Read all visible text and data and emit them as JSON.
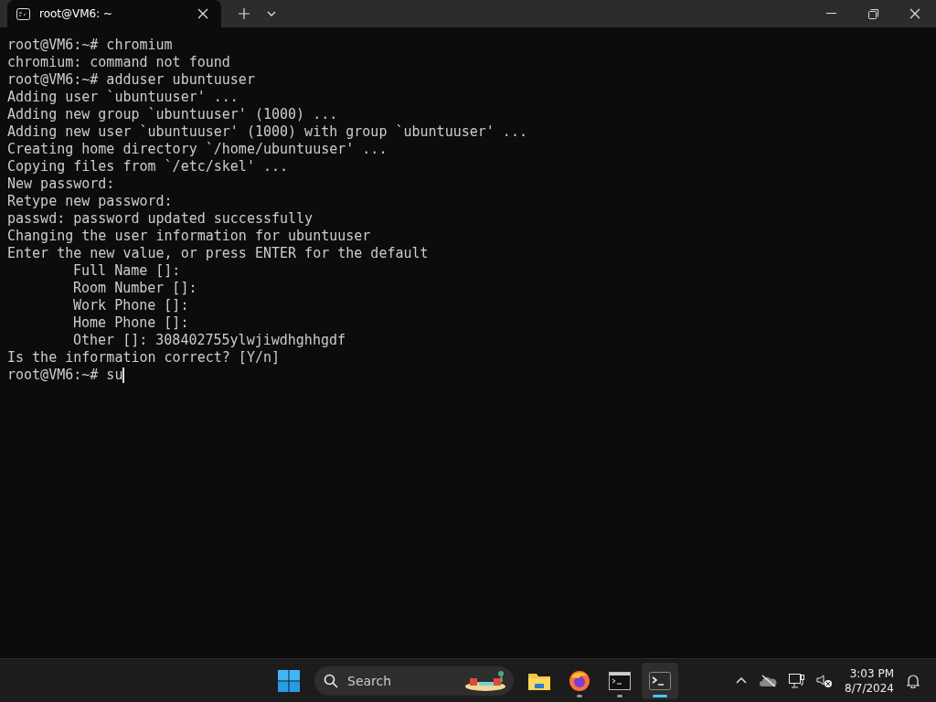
{
  "window": {
    "tab_title": "root@VM6: ~"
  },
  "terminal": {
    "lines": [
      {
        "text": "root@VM6:~# chromium",
        "indent": false
      },
      {
        "text": "chromium: command not found",
        "indent": false
      },
      {
        "text": "root@VM6:~# adduser ubuntuuser",
        "indent": false
      },
      {
        "text": "Adding user `ubuntuuser' ...",
        "indent": false
      },
      {
        "text": "Adding new group `ubuntuuser' (1000) ...",
        "indent": false
      },
      {
        "text": "Adding new user `ubuntuuser' (1000) with group `ubuntuuser' ...",
        "indent": false
      },
      {
        "text": "Creating home directory `/home/ubuntuuser' ...",
        "indent": false
      },
      {
        "text": "Copying files from `/etc/skel' ...",
        "indent": false
      },
      {
        "text": "New password:",
        "indent": false
      },
      {
        "text": "Retype new password:",
        "indent": false
      },
      {
        "text": "passwd: password updated successfully",
        "indent": false
      },
      {
        "text": "Changing the user information for ubuntuuser",
        "indent": false
      },
      {
        "text": "Enter the new value, or press ENTER for the default",
        "indent": false
      },
      {
        "text": "Full Name []:",
        "indent": true
      },
      {
        "text": "Room Number []:",
        "indent": true
      },
      {
        "text": "Work Phone []:",
        "indent": true
      },
      {
        "text": "Home Phone []:",
        "indent": true
      },
      {
        "text": "Other []: 308402755ylwjiwdhghhgdf",
        "indent": true
      },
      {
        "text": "Is the information correct? [Y/n]",
        "indent": false
      },
      {
        "text": "root@VM6:~# su",
        "indent": false,
        "cursor": true
      }
    ]
  },
  "taskbar": {
    "search": {
      "placeholder": "Search"
    },
    "apps": [
      {
        "kind": "folder",
        "running": false,
        "selected": false
      },
      {
        "kind": "firefox",
        "running": true,
        "selected": false
      },
      {
        "kind": "console",
        "running": true,
        "selected": false
      },
      {
        "kind": "terminal",
        "running": true,
        "selected": true
      }
    ],
    "clock": {
      "time": "3:03 PM",
      "date": "8/7/2024"
    }
  }
}
